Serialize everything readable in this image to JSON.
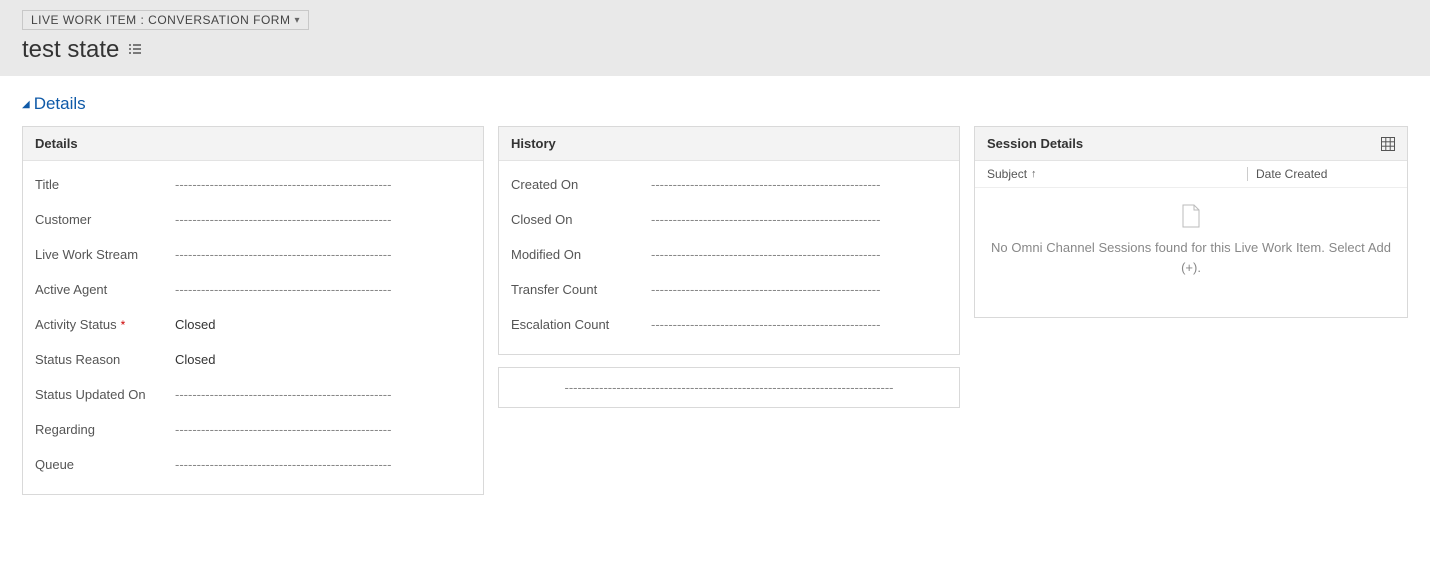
{
  "header": {
    "breadcrumb": "LIVE WORK ITEM : CONVERSATION FORM",
    "record_title": "test state"
  },
  "section": {
    "title": "Details"
  },
  "details_panel": {
    "title": "Details",
    "fields": {
      "title": {
        "label": "Title",
        "value": "--------------------------------------------------"
      },
      "customer": {
        "label": "Customer",
        "value": "--------------------------------------------------"
      },
      "live_work_stream": {
        "label": "Live Work Stream",
        "value": "--------------------------------------------------"
      },
      "active_agent": {
        "label": "Active Agent",
        "value": "--------------------------------------------------"
      },
      "activity_status": {
        "label": "Activity Status",
        "value": "Closed",
        "required": true
      },
      "status_reason": {
        "label": "Status Reason",
        "value": "Closed"
      },
      "status_updated_on": {
        "label": "Status Updated On",
        "value": "--------------------------------------------------"
      },
      "regarding": {
        "label": "Regarding",
        "value": "--------------------------------------------------"
      },
      "queue": {
        "label": "Queue",
        "value": "--------------------------------------------------"
      }
    }
  },
  "history_panel": {
    "title": "History",
    "fields": {
      "created_on": {
        "label": "Created On",
        "value": "-----------------------------------------------------"
      },
      "closed_on": {
        "label": "Closed On",
        "value": "-----------------------------------------------------"
      },
      "modified_on": {
        "label": "Modified On",
        "value": "-----------------------------------------------------"
      },
      "transfer_count": {
        "label": "Transfer Count",
        "value": "-----------------------------------------------------"
      },
      "escalation_count": {
        "label": "Escalation Count",
        "value": "-----------------------------------------------------"
      }
    }
  },
  "notes_panel": {
    "value": "----------------------------------------------------------------------------"
  },
  "session_panel": {
    "title": "Session Details",
    "columns": {
      "subject": "Subject",
      "date_created": "Date Created"
    },
    "empty_message": "No Omni Channel Sessions found for this Live Work Item. Select Add (+)."
  }
}
